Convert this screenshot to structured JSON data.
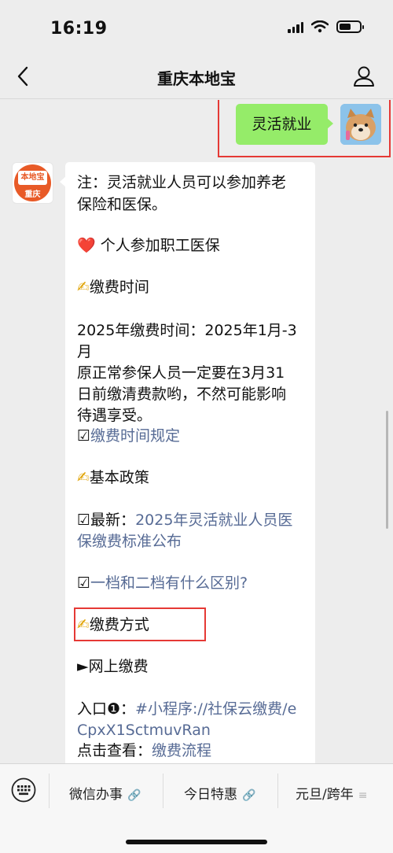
{
  "status_bar": {
    "time": "16:19"
  },
  "nav": {
    "title": "重庆本地宝",
    "back_icon": "chevron-left-icon",
    "profile_icon": "person-icon"
  },
  "sent_message": {
    "text": "灵活就业"
  },
  "bot_avatar": {
    "logo_top": "本地宝",
    "logo_bottom": "重庆"
  },
  "received_message": {
    "note_1": "注：灵活就业人员可以参加养老",
    "note_2": "保险和医保。",
    "heart_emoji": "❤️",
    "section_1": "个人参加职工医保",
    "writing_emoji": "✍",
    "section_time": "缴费时间",
    "time_1": "2025年缴费时间：2025年1月-3",
    "time_2": "月",
    "time_3": "原正常参保人员一定要在3月31",
    "time_4": "日前缴清费款哟，不然可能影响",
    "time_5": "待遇享受。",
    "box_glyph": "☑",
    "link_time_rules": "缴费时间规定",
    "section_policy": "基本政策",
    "latest_prefix": "最新：",
    "link_latest_1": "2025年灵活就业人员医",
    "link_latest_2": "保缴费标准公布",
    "link_difference": "一档和二档有什么区别?",
    "section_way": "缴费方式",
    "online_payment": "►网上缴费",
    "entry_prefix": "入口❶：",
    "link_entry_1": "#小程序://社保云缴费/e",
    "link_entry_2": "CpxX1SctmuvRan",
    "click_prefix": "点击查看：",
    "link_flow": "缴费流程"
  },
  "bottom_menu": {
    "keyboard_icon": "keyboard-icon",
    "items": [
      {
        "label": "微信办事",
        "suffix": "🔗"
      },
      {
        "label": "今日特惠",
        "suffix": "🔗"
      },
      {
        "label": "元旦/跨年",
        "suffix": "≡"
      }
    ]
  },
  "colors": {
    "background": "#ededed",
    "sent_bubble": "#95ec69",
    "link": "#576b95",
    "highlight": "#e53935",
    "logo": "#e85a27"
  }
}
